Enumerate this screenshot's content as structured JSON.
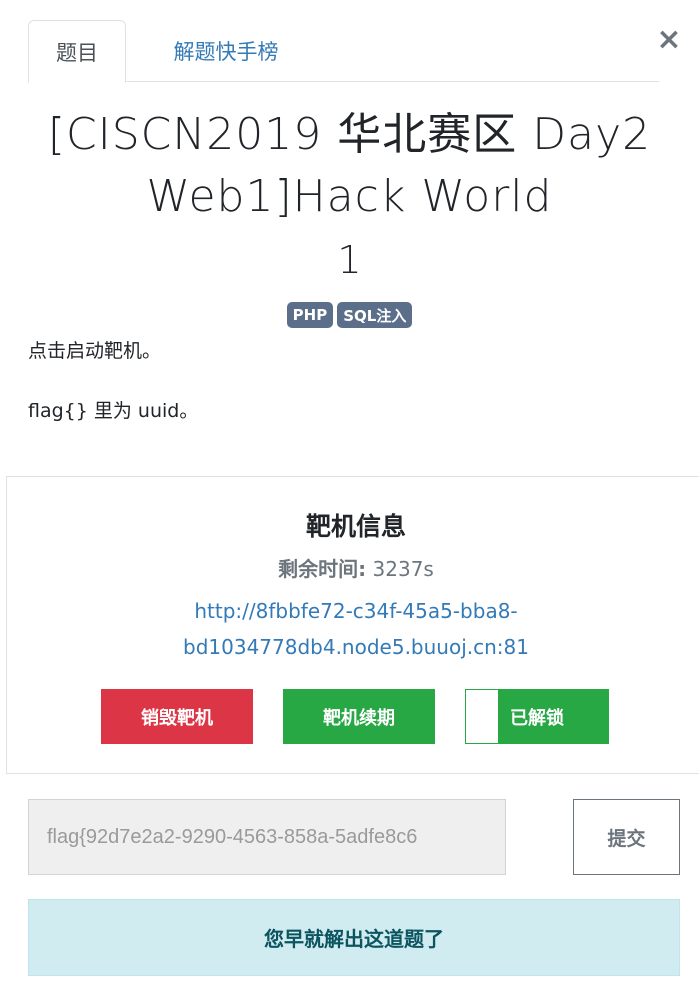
{
  "tabs": {
    "challenge": "题目",
    "solves": "解题快手榜"
  },
  "close_symbol": "×",
  "challenge": {
    "title_line1": "[CISCN2019 华北赛区 Day2",
    "title_line2": "Web1]Hack World",
    "score": "1",
    "tags": [
      "PHP",
      "SQL注入"
    ],
    "description": [
      "点击启动靶机。",
      "flag{} 里为 uuid。"
    ]
  },
  "target": {
    "heading": "靶机信息",
    "time_label": "剩余时间:",
    "time_value": "3237s",
    "url_line1": "http://8fbbfe72-c34f-45a5-bba8-",
    "url_line2": "bd1034778db4.node5.buuoj.cn:81",
    "destroy_label": "销毁靶机",
    "renew_label": "靶机续期",
    "unlock_label": "已解锁"
  },
  "flag": {
    "value": "flag{92d7e2a2-9290-4563-858a-5adfe8c6",
    "submit_label": "提交"
  },
  "solved_message": "您早就解出这道题了",
  "colors": {
    "link": "#337ab7",
    "danger": "#dc3545",
    "success": "#28a745",
    "tag": "#5b6e8a",
    "info_bg": "#d1ecf1",
    "info_text": "#0c5460"
  }
}
